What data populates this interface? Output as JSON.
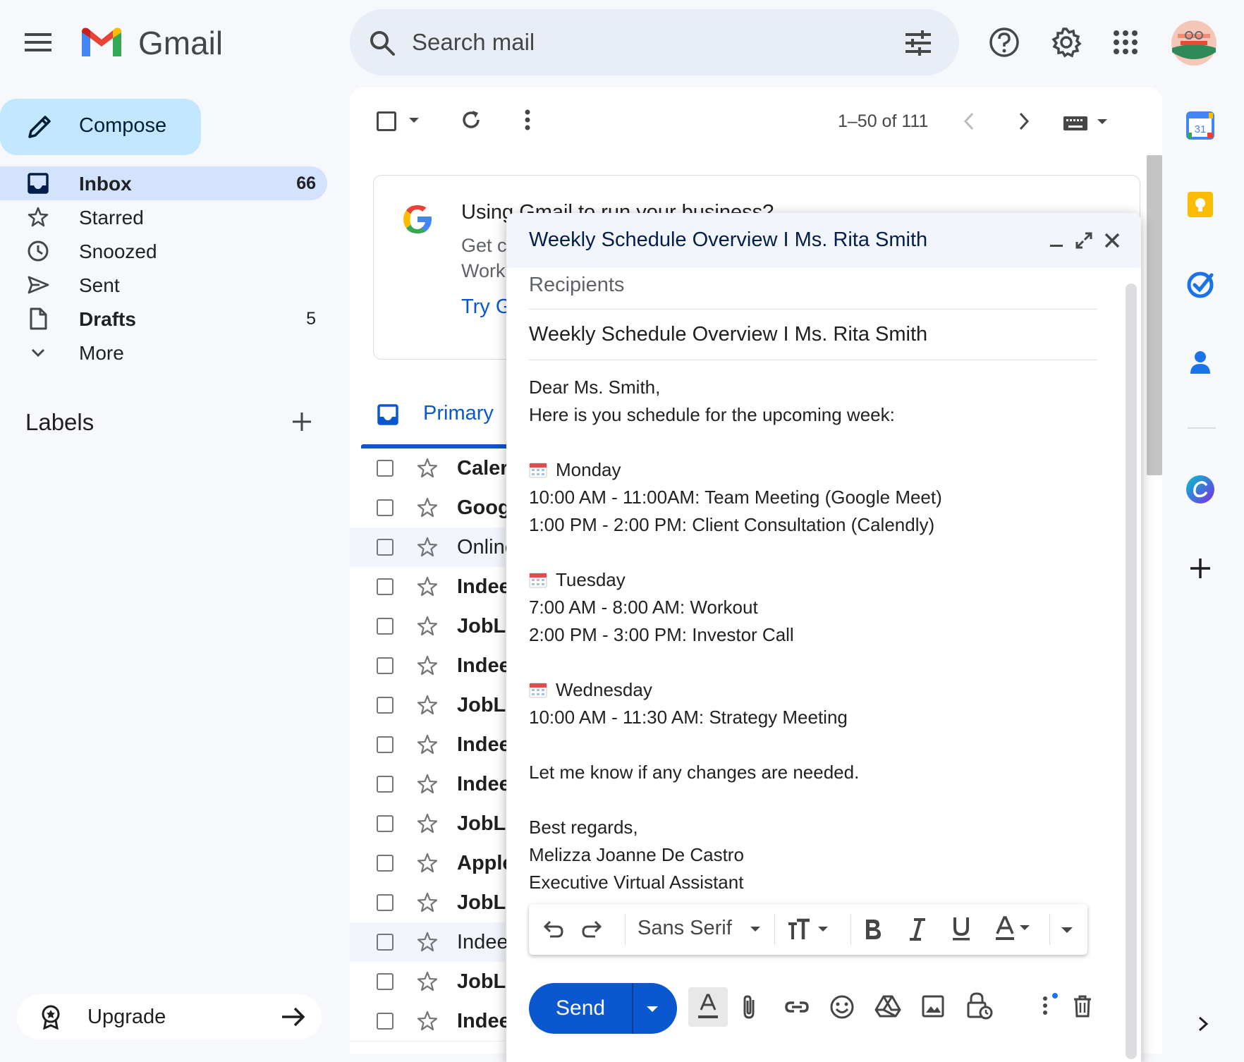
{
  "app": {
    "name": "Gmail"
  },
  "search": {
    "placeholder": "Search mail"
  },
  "compose_button": {
    "label": "Compose"
  },
  "nav": [
    {
      "label": "Inbox",
      "count": "66",
      "active": true,
      "bold": true
    },
    {
      "label": "Starred",
      "count": ""
    },
    {
      "label": "Snoozed",
      "count": ""
    },
    {
      "label": "Sent",
      "count": ""
    },
    {
      "label": "Drafts",
      "count": "5",
      "bold": true
    },
    {
      "label": "More",
      "count": ""
    }
  ],
  "labels": {
    "title": "Labels"
  },
  "upgrade": {
    "label": "Upgrade"
  },
  "toolbar": {
    "page_range": "1–50 of 111"
  },
  "promo": {
    "title": "Using Gmail to run your business?",
    "line1": "Get c",
    "line2": "Work",
    "link": "Try G"
  },
  "tabs": {
    "primary": "Primary"
  },
  "rows": [
    {
      "sender": "Caler",
      "unread": true
    },
    {
      "sender": "Goog",
      "unread": true
    },
    {
      "sender": "Online",
      "unread": false
    },
    {
      "sender": "Indee",
      "unread": true
    },
    {
      "sender": "JobLe",
      "unread": true
    },
    {
      "sender": "Indee",
      "unread": true
    },
    {
      "sender": "JobLe",
      "unread": true
    },
    {
      "sender": "Indee",
      "unread": true
    },
    {
      "sender": "Indee",
      "unread": true
    },
    {
      "sender": "JobLe",
      "unread": true
    },
    {
      "sender": "Apple",
      "unread": true
    },
    {
      "sender": "JobLe",
      "unread": true
    },
    {
      "sender": "Indee",
      "unread": false
    },
    {
      "sender": "JobLe",
      "unread": true
    },
    {
      "sender": "Indee",
      "unread": true
    }
  ],
  "rail": {
    "calendar_day": "31"
  },
  "compose_window": {
    "title": "Weekly Schedule Overview I Ms. Rita Smith",
    "recipients_placeholder": "Recipients",
    "subject": "Weekly Schedule Overview I Ms. Rita Smith",
    "body": [
      {
        "text": "Dear Ms. Smith,",
        "emoji": false
      },
      {
        "text": "Here is you schedule for the upcoming week:",
        "emoji": false
      },
      {
        "text": "",
        "emoji": false
      },
      {
        "text": "Monday",
        "emoji": true
      },
      {
        "text": "10:00 AM - 11:00AM: Team Meeting (Google Meet)",
        "emoji": false
      },
      {
        "text": "1:00 PM - 2:00 PM: Client Consultation (Calendly)",
        "emoji": false
      },
      {
        "text": "",
        "emoji": false
      },
      {
        "text": "Tuesday",
        "emoji": true
      },
      {
        "text": "7:00 AM - 8:00 AM: Workout",
        "emoji": false
      },
      {
        "text": "2:00 PM - 3:00 PM: Investor Call",
        "emoji": false
      },
      {
        "text": "",
        "emoji": false
      },
      {
        "text": "Wednesday",
        "emoji": true
      },
      {
        "text": "10:00 AM - 11:30 AM: Strategy Meeting",
        "emoji": false
      },
      {
        "text": "",
        "emoji": false
      },
      {
        "text": "Let me know if any changes are needed.",
        "emoji": false
      },
      {
        "text": "",
        "emoji": false
      },
      {
        "text": "Best regards,",
        "emoji": false
      },
      {
        "text": "Melizza Joanne De Castro",
        "emoji": false
      },
      {
        "text": "Executive Virtual Assistant",
        "emoji": false
      }
    ],
    "format_bar": {
      "font": "Sans Serif"
    },
    "send_label": "Send"
  },
  "colors": {
    "accent": "#0b57d0",
    "compose": "#c2e7ff",
    "nav_active": "#d3e3fd"
  }
}
